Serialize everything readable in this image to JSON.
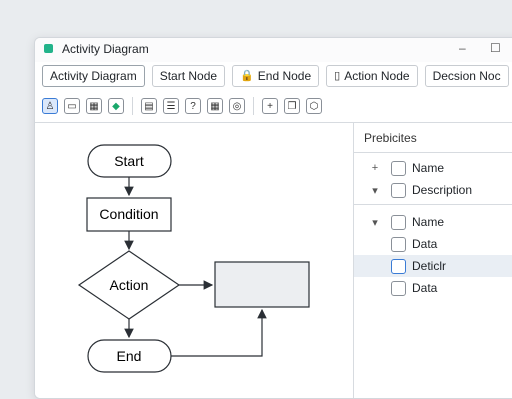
{
  "window": {
    "title": "Activity Diagram",
    "minimize": "–",
    "maximize": "☐"
  },
  "tabs": [
    {
      "label": "Activity Diagram",
      "icon": ""
    },
    {
      "label": "Start Node",
      "icon": ""
    },
    {
      "label": "End Node",
      "icon": "🔒"
    },
    {
      "label": "Action Node",
      "icon": "▯"
    },
    {
      "label": "Decsion Noc",
      "icon": ""
    }
  ],
  "toolbar": {
    "group1": [
      "user-icon",
      "window-icon",
      "calendar-icon",
      "diamond-icon"
    ],
    "group2": [
      "card-icon",
      "document-icon",
      "help-icon",
      "grid-icon",
      "target-icon"
    ],
    "group3": [
      "plus-node-icon",
      "copy-icon",
      "shape-icon"
    ]
  },
  "diagram": {
    "start": "Start",
    "condition": "Condition",
    "action": "Action",
    "end": "End"
  },
  "panel": {
    "title": "Prebicites",
    "group1": [
      {
        "expander": "+",
        "label": "Name"
      },
      {
        "expander": "▾",
        "label": "Description"
      }
    ],
    "group2": [
      {
        "expander": "▾",
        "label": "Name"
      },
      {
        "expander": "",
        "label": "Data"
      },
      {
        "expander": "",
        "label": "Deticlr",
        "highlighted": true
      },
      {
        "expander": "",
        "label": "Data"
      }
    ]
  },
  "colors": {
    "accent": "#22b38a",
    "selection": "#3a7bd5",
    "canvas_bg": "#ffffff",
    "node_fill": "#eceef1"
  }
}
